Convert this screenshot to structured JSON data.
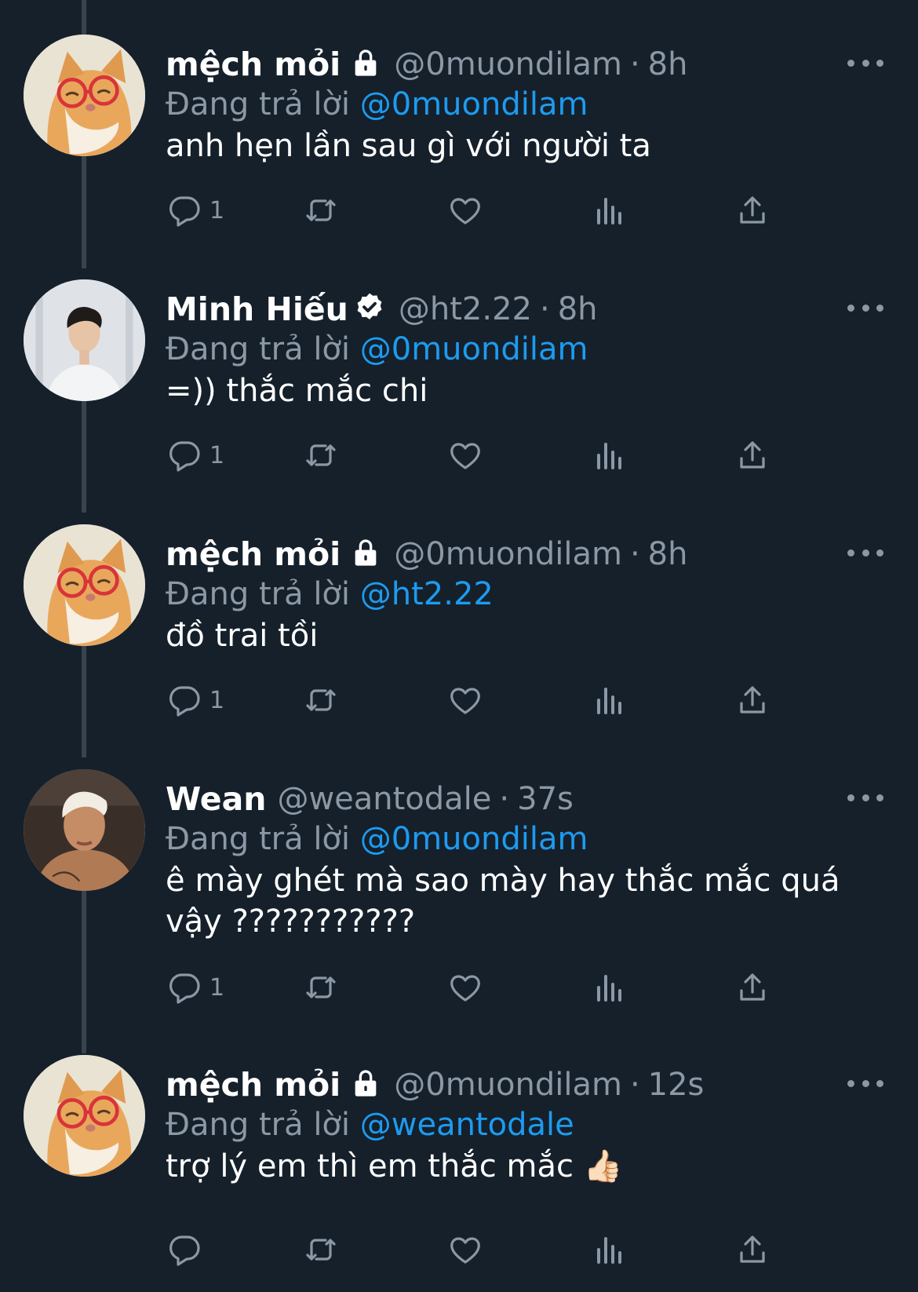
{
  "tweets": [
    {
      "name": "mệch mỏi",
      "badge": "lock",
      "handle": "@0muondilam",
      "time": "8h",
      "reply_prefix": "Đang trả lời",
      "reply_to": "@0muondilam",
      "text": "anh hẹn lần sau gì với người ta",
      "reply_count": "1",
      "avatar": "cat-avatar"
    },
    {
      "name": "Minh Hiếu",
      "badge": "verified",
      "handle": "@ht2.22",
      "time": "8h",
      "reply_prefix": "Đang trả lời",
      "reply_to": "@0muondilam",
      "text": "=)) thắc mắc chi",
      "reply_count": "1",
      "avatar": "man-avatar"
    },
    {
      "name": "mệch mỏi",
      "badge": "lock",
      "handle": "@0muondilam",
      "time": "8h",
      "reply_prefix": "Đang trả lời",
      "reply_to": "@ht2.22",
      "text": "đồ trai tồi",
      "reply_count": "1",
      "avatar": "cat-avatar"
    },
    {
      "name": "Wean",
      "badge": "",
      "handle": "@weantodale",
      "time": "37s",
      "reply_prefix": "Đang trả lời",
      "reply_to": "@0muondilam",
      "text": "ê mày ghét mà sao mày hay thắc mắc quá vậy ???????????",
      "reply_count": "1",
      "avatar": "selfie-avatar"
    },
    {
      "name": "mệch mỏi",
      "badge": "lock",
      "handle": "@0muondilam",
      "time": "12s",
      "reply_prefix": "Đang trả lời",
      "reply_to": "@weantodale",
      "text": "trợ lý em thì em thắc mắc 👍🏻",
      "reply_count": "",
      "avatar": "cat-avatar"
    }
  ],
  "separator": "·",
  "icons": {
    "reply": "reply-icon",
    "retweet": "retweet-icon",
    "like": "heart-icon",
    "views": "views-icon",
    "share": "share-icon",
    "more": "more-icon"
  },
  "colors": {
    "background": "#15202b",
    "text": "#ffffff",
    "secondary": "#8b98a5",
    "accent": "#1d9bf0",
    "thread_line": "#38444d"
  }
}
